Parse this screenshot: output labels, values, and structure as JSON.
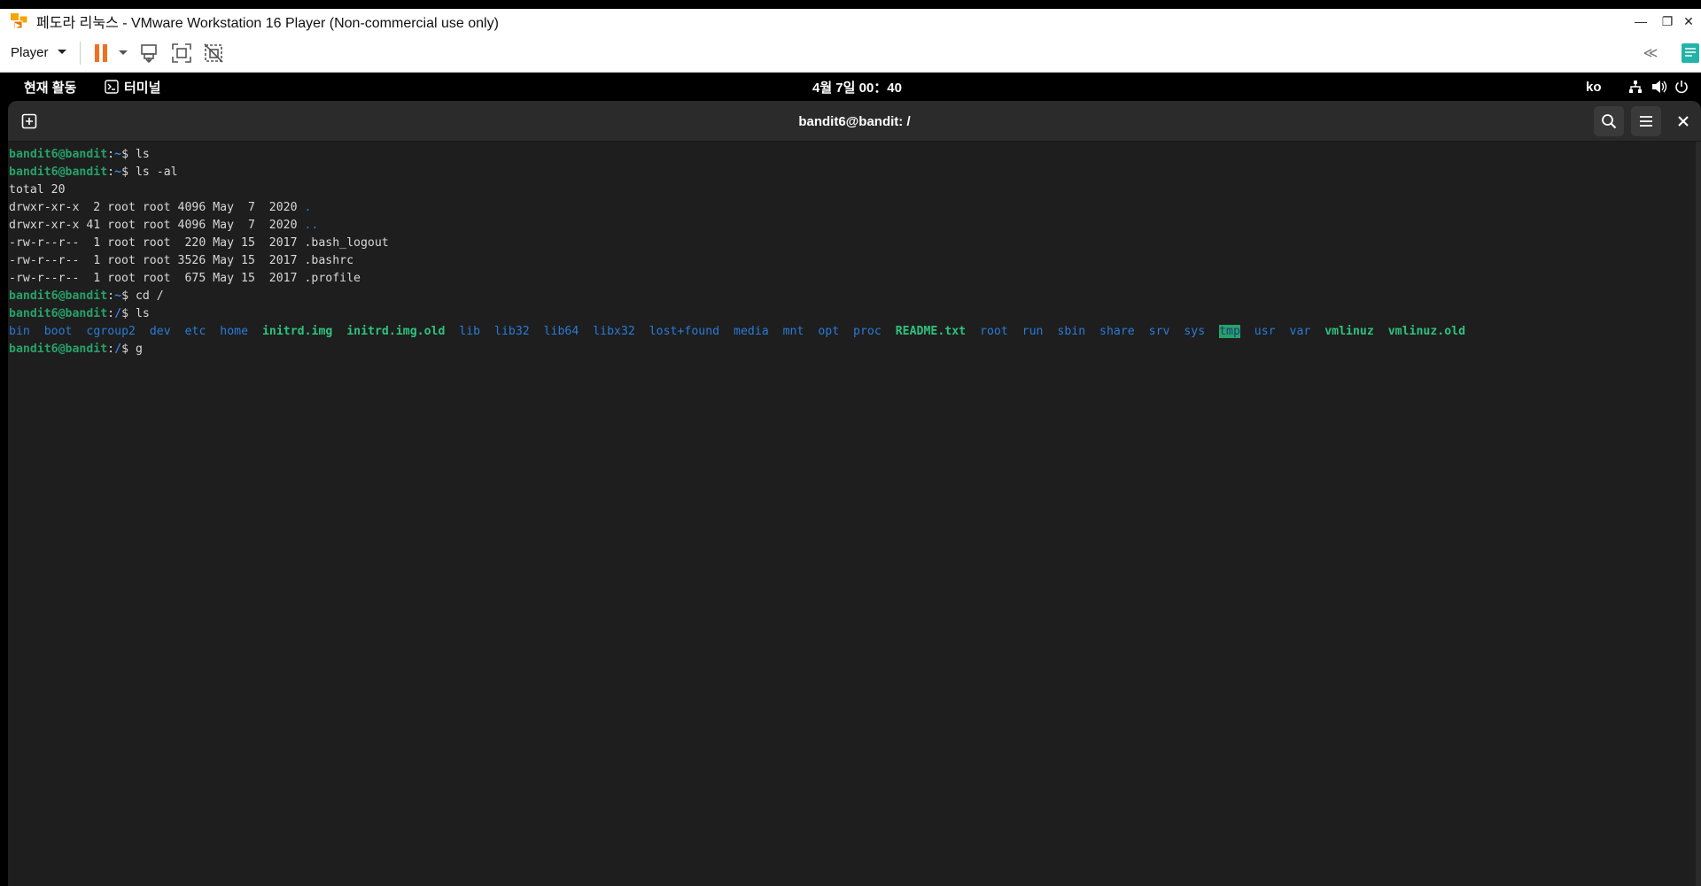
{
  "window": {
    "title": "페도라 리눅스 - VMware Workstation 16 Player (Non-commercial use only)",
    "controls": {
      "minimize": "—",
      "restore": "❐",
      "close": "✕"
    }
  },
  "toolbar": {
    "player_menu": "Player",
    "icons": [
      "pause-icon",
      "send-ctrl-alt-del-icon",
      "fullscreen-icon",
      "unity-icon",
      "collapse-icon",
      "notes-icon"
    ]
  },
  "gnome_bar": {
    "activities": "현재 활동",
    "app_name": "터미널",
    "clock": "4월 7일  00：40",
    "input_method": "ko",
    "status_icons": [
      "network-icon",
      "volume-icon",
      "power-icon"
    ]
  },
  "terminal": {
    "title": "bandit6@bandit: /",
    "prompt_user": "bandit6@bandit",
    "prompt_sep": ":",
    "lines": {
      "l1_path": "~",
      "l1_cmd": "$ ls",
      "l2_path": "~",
      "l2_cmd": "$ ls -al",
      "l3": "total 20",
      "l4_meta": "drwxr-xr-x  2 root root 4096 May  7  2020 ",
      "l4_name": ".",
      "l5_meta": "drwxr-xr-x 41 root root 4096 May  7  2020 ",
      "l5_name": "..",
      "l6": "-rw-r--r--  1 root root  220 May 15  2017 .bash_logout",
      "l7": "-rw-r--r--  1 root root 3526 May 15  2017 .bashrc",
      "l8": "-rw-r--r--  1 root root  675 May 15  2017 .profile",
      "l9_path": "~",
      "l9_cmd": "$ cd /",
      "l10_path": "/",
      "l10_cmd": "$ ls",
      "l12_path": "/",
      "l12_cmd": "$ g"
    },
    "ls_root": [
      {
        "name": "bin",
        "kind": "dir"
      },
      {
        "name": "boot",
        "kind": "dir"
      },
      {
        "name": "cgroup2",
        "kind": "dir"
      },
      {
        "name": "dev",
        "kind": "dir"
      },
      {
        "name": "etc",
        "kind": "dir"
      },
      {
        "name": "home",
        "kind": "dir"
      },
      {
        "name": "initrd.img",
        "kind": "link"
      },
      {
        "name": "initrd.img.old",
        "kind": "link"
      },
      {
        "name": "lib",
        "kind": "dir"
      },
      {
        "name": "lib32",
        "kind": "dir"
      },
      {
        "name": "lib64",
        "kind": "dir"
      },
      {
        "name": "libx32",
        "kind": "dir"
      },
      {
        "name": "lost+found",
        "kind": "dir"
      },
      {
        "name": "media",
        "kind": "dir"
      },
      {
        "name": "mnt",
        "kind": "dir"
      },
      {
        "name": "opt",
        "kind": "dir"
      },
      {
        "name": "proc",
        "kind": "dir"
      },
      {
        "name": "README.txt",
        "kind": "file-bold"
      },
      {
        "name": "root",
        "kind": "dir"
      },
      {
        "name": "run",
        "kind": "dir"
      },
      {
        "name": "sbin",
        "kind": "dir"
      },
      {
        "name": "share",
        "kind": "dir"
      },
      {
        "name": "srv",
        "kind": "dir"
      },
      {
        "name": "sys",
        "kind": "dir"
      },
      {
        "name": "tmp",
        "kind": "sticky"
      },
      {
        "name": "usr",
        "kind": "dir"
      },
      {
        "name": "var",
        "kind": "dir"
      },
      {
        "name": "vmlinuz",
        "kind": "link"
      },
      {
        "name": "vmlinuz.old",
        "kind": "link"
      }
    ]
  },
  "colors": {
    "prompt_user": "#26a269",
    "prompt_path": "#3584e4",
    "directory": "#2a7bd8",
    "link": "#2ec27e",
    "terminal_bg": "#1e1e1e",
    "header_bg": "#2b2b2b"
  }
}
